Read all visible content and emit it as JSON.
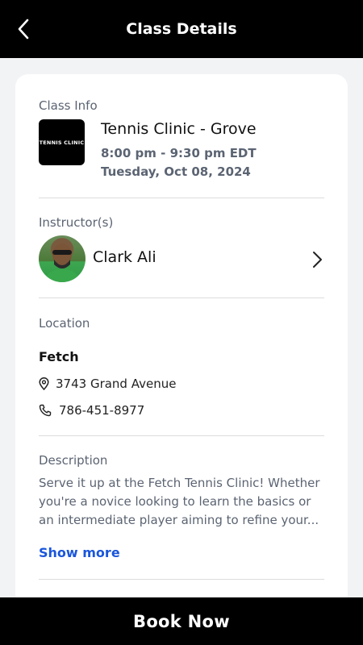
{
  "header": {
    "title": "Class Details",
    "back_icon": "chevron-left-icon"
  },
  "class_info": {
    "section_label": "Class Info",
    "logo_text": "TENNIS CLINIC",
    "name": "Tennis Clinic - Grove",
    "time": "8:00 pm - 9:30 pm EDT",
    "date": "Tuesday, Oct 08, 2024"
  },
  "instructors": {
    "section_label": "Instructor(s)",
    "name": "Clark Ali",
    "chevron_icon": "chevron-right-icon"
  },
  "location": {
    "section_label": "Location",
    "name": "Fetch",
    "address": "3743 Grand Avenue",
    "address_icon": "map-pin-icon",
    "phone": "786-451-8977",
    "phone_icon": "phone-icon"
  },
  "description": {
    "section_label": "Description",
    "text": " Serve it up at the Fetch Tennis Clinic! Whether you're a novice looking to learn the basics or an intermediate player aiming to refine your...",
    "show_more_label": "Show more"
  },
  "footer": {
    "book_label": "Book Now"
  },
  "colors": {
    "header_bg": "#000000",
    "link": "#1a56db",
    "muted_text": "#5b6472",
    "page_bg": "#f2f3f5"
  }
}
